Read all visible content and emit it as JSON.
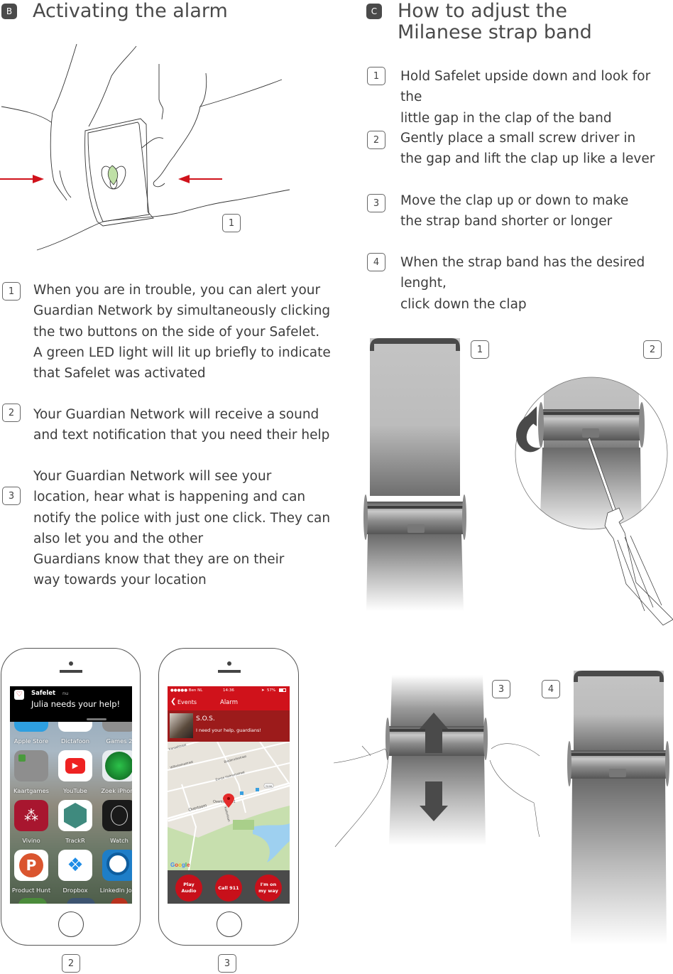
{
  "section_b": {
    "badge": "B",
    "title": "Activating the alarm",
    "illustration_label": "1",
    "steps": [
      {
        "num": "1",
        "text": "When you are in trouble, you can alert your\nGuardian Network by simultaneously clicking\nthe two buttons on the side of your Safelet.\nA green LED light will lit up briefly to indicate\nthat Safelet was activated"
      },
      {
        "num": "2",
        "text": "Your Guardian Network will receive a sound\nand text notification that you need their help"
      },
      {
        "num": "3",
        "text": "Your Guardian Network will see your\nlocation, hear what is happening and can\nnotify the police with just one click. They can\nalso let you and the other\nGuardians know that they are on their\nway towards your location"
      }
    ],
    "led_color": "#bfe0a6",
    "arrow_color": "#d0121b"
  },
  "section_c": {
    "badge": "C",
    "title_line1": "How to adjust the",
    "title_line2": "Milanese strap band",
    "steps": [
      {
        "num": "1",
        "text": "Hold Safelet upside down and look for the\nlittle gap in the clap of the band"
      },
      {
        "num": "2",
        "text": "Gently place a small screw driver in\nthe gap and lift the clap up like a lever"
      },
      {
        "num": "3",
        "text": "Move the clap up or down to make\nthe strap band shorter or longer"
      },
      {
        "num": "4",
        "text": "When the strap band has the desired lenght,\nclick down the clap"
      }
    ],
    "figure_labels": [
      "1",
      "2",
      "3",
      "4"
    ]
  },
  "phone_home": {
    "label": "2",
    "notification": {
      "app": "Safelet",
      "time": "nu",
      "message": "Julia needs your help!"
    },
    "apps": [
      {
        "name": "Apple Store",
        "color": "#2e9fe0"
      },
      {
        "name": "Dictafoon",
        "color": "#ffffff"
      },
      {
        "name": "Games 2",
        "color": "#8e8e8e"
      },
      {
        "name": "Kaartgames",
        "color": "#8e8e8e"
      },
      {
        "name": "YouTube",
        "color": "#ffffff"
      },
      {
        "name": "Zoek iPhone",
        "color": "#1e7d2e"
      },
      {
        "name": "Vivino",
        "color": "#a8162f"
      },
      {
        "name": "TrackR",
        "color": "#ffffff"
      },
      {
        "name": "Watch",
        "color": "#1a1a1a"
      },
      {
        "name": "Product Hunt",
        "color": "#ffffff"
      },
      {
        "name": "Dropbox",
        "color": "#ffffff"
      },
      {
        "name": "LinkedIn Jobs",
        "color": "#1e7ec8"
      }
    ]
  },
  "phone_alarm": {
    "label": "3",
    "status": {
      "carrier": "●●●●● Ben NL",
      "time": "14:36",
      "battery": "57%"
    },
    "nav": {
      "back": "Events",
      "title": "Alarm"
    },
    "alert": {
      "title": "S.O.S.",
      "message": "I need your help, guardians!"
    },
    "map": {
      "streets": [
        "Kanaalstraat",
        "Wilhelminastraat",
        "Brederodestraat",
        "Eerste Helmersstraat",
        "Overtoom",
        "Kattenlaan"
      ],
      "route_badge": "S106",
      "address": "Overtoom 301",
      "provider": "Google"
    },
    "actions": [
      "Play\nAudio",
      "Call 911",
      "I'm on\nmy way"
    ],
    "accent": "#d0121b"
  }
}
